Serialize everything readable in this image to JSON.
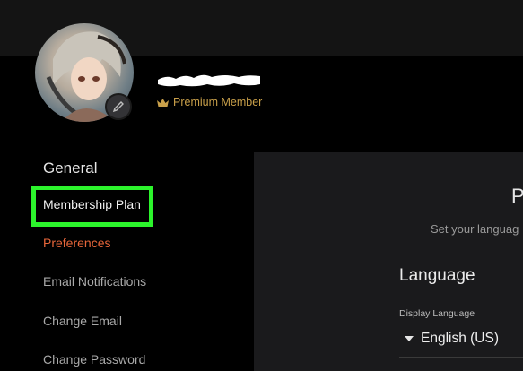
{
  "profile": {
    "membership_badge": "Premium Member"
  },
  "sidebar": {
    "heading": "General",
    "items": [
      {
        "label": "Membership Plan"
      },
      {
        "label": "Preferences"
      },
      {
        "label": "Email Notifications"
      },
      {
        "label": "Change Email"
      },
      {
        "label": "Change Password"
      }
    ]
  },
  "main": {
    "title": "P",
    "subtitle": "Set your languag",
    "section_heading": "Language",
    "display_language_label": "Display Language",
    "display_language_value": "English (US)"
  },
  "colors": {
    "accent": "#e8663a",
    "premium": "#c9a04a",
    "highlight": "#2cf42c"
  },
  "icons": {
    "edit_avatar": "pencil-icon",
    "membership": "crown-icon",
    "dropdown": "caret-down-icon"
  }
}
